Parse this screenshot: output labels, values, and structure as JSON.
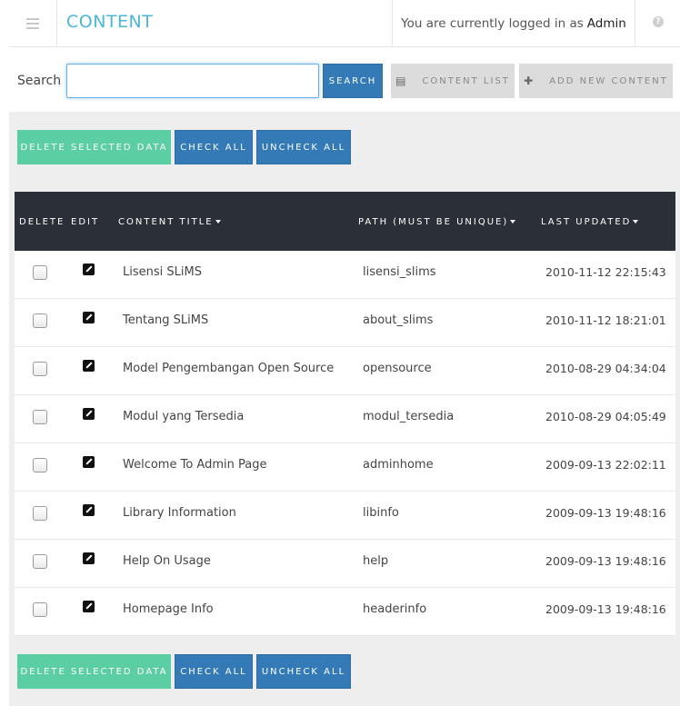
{
  "header": {
    "title": "CONTENT",
    "login_prefix": "You are currently logged in as",
    "login_user": "Admin",
    "help_glyph": "?"
  },
  "search": {
    "label": "Search :",
    "value": "",
    "button": "Search"
  },
  "toolbar": {
    "content_list": "Content List",
    "add_new_content": "Add New Content"
  },
  "actions": {
    "delete_selected": "Delete Selected Data",
    "check_all": "Check All",
    "uncheck_all": "Uncheck All"
  },
  "table": {
    "headers": {
      "delete": "Delete",
      "edit": "Edit",
      "title": "Content Title",
      "path": "Path (Must be unique)",
      "updated": "Last Updated"
    },
    "rows": [
      {
        "title": "Lisensi SLiMS",
        "path": "lisensi_slims",
        "updated": "2010-11-12 22:15:43"
      },
      {
        "title": "Tentang SLiMS",
        "path": "about_slims",
        "updated": "2010-11-12 18:21:01"
      },
      {
        "title": "Model Pengembangan Open Source",
        "path": "opensource",
        "updated": "2010-08-29 04:34:04"
      },
      {
        "title": "Modul yang Tersedia",
        "path": "modul_tersedia",
        "updated": "2010-08-29 04:05:49"
      },
      {
        "title": "Welcome To Admin Page",
        "path": "adminhome",
        "updated": "2009-09-13 22:02:11"
      },
      {
        "title": "Library Information",
        "path": "libinfo",
        "updated": "2009-09-13 19:48:16"
      },
      {
        "title": "Help On Usage",
        "path": "help",
        "updated": "2009-09-13 19:48:16"
      },
      {
        "title": "Homepage Info",
        "path": "headerinfo",
        "updated": "2009-09-13 19:48:16"
      }
    ]
  },
  "colors": {
    "accent": "#4ab6d8",
    "primary": "#337ab7",
    "success": "#5ccea3",
    "table_header": "#2b2f37"
  },
  "icons": {
    "menu": "hamburger-icon",
    "help": "question-circle-icon",
    "content_list": "list-icon",
    "add": "plus-icon",
    "edit": "pencil-icon"
  }
}
